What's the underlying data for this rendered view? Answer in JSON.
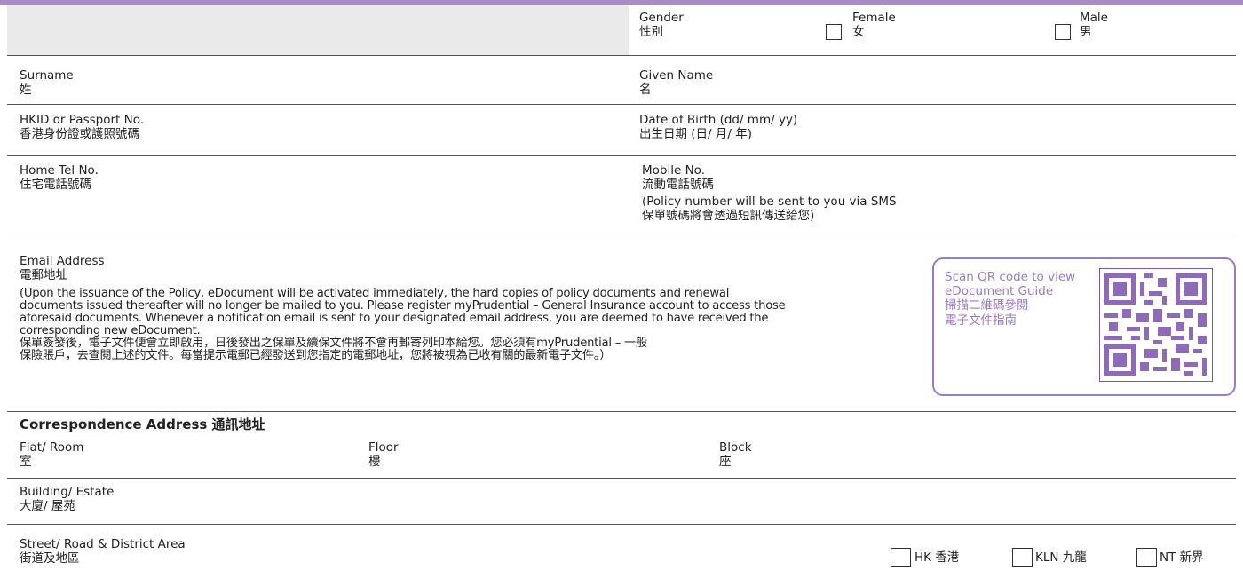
{
  "gender": {
    "label_en": "Gender",
    "label_zh": "性別",
    "female_en": "Female",
    "female_zh": "女",
    "male_en": "Male",
    "male_zh": "男"
  },
  "surname": {
    "en": "Surname",
    "zh": "姓"
  },
  "given_name": {
    "en": "Given Name",
    "zh": "名"
  },
  "hkid": {
    "en": "HKID or Passport No.",
    "zh": "香港身份證或護照號碼"
  },
  "dob": {
    "en": "Date of Birth (dd/ mm/ yy)",
    "zh": "出生日期 (日/ 月/ 年)"
  },
  "home_tel": {
    "en": "Home Tel No.",
    "zh": "住宅電話號碼"
  },
  "mobile": {
    "en": "Mobile No.",
    "zh": "流動電話號碼",
    "note_en": "(Policy number will be sent to you via SMS",
    "note_zh": "保單號碼將會透過短訊傳送給您)"
  },
  "email": {
    "en": "Email Address",
    "zh": "電郵地址",
    "note_en_1": "(Upon the issuance of the Policy, eDocument will be activated immediately, the hard copies of policy documents and renewal",
    "note_en_2": "documents issued thereafter will no longer be mailed to you. Please register myPrudential – General Insurance account to access those",
    "note_en_3": "aforesaid documents.  Whenever a notification email is sent to your designated email address, you are deemed to have received the",
    "note_en_4": "corresponding new eDocument.",
    "note_zh_1": "保單簽發後，電子文件便會立即啟用，日後發出之保單及續保文件將不會再郵寄列印本給您。您必須有myPrudential – 一般",
    "note_zh_2": "保險賬戶，去查閱上述的文件。每當提示電郵已經發送到您指定的電郵地址，您將被視為已收有關的最新電子文件。）"
  },
  "qr": {
    "en_1": "Scan QR code to view",
    "en_2": "eDocument Guide",
    "zh_1": "掃描二維碼參閱",
    "zh_2": "電子文件指南",
    "color": "#9a7cc2"
  },
  "address": {
    "heading": "Correspondence Address 通訊地址",
    "flat": {
      "en": "Flat/ Room",
      "zh": "室"
    },
    "floor": {
      "en": "Floor",
      "zh": "樓"
    },
    "block": {
      "en": "Block",
      "zh": "座"
    },
    "building": {
      "en": "Building/ Estate",
      "zh": "大廈/ 屋苑"
    },
    "street": {
      "en": "Street/ Road & District Area",
      "zh": "街道及地區"
    },
    "hk": "HK 香港",
    "kln": "KLN 九龍",
    "nt": "NT 新界"
  },
  "colors": {
    "accent": "#a98ac6",
    "grey_fill": "#eaeaea"
  }
}
